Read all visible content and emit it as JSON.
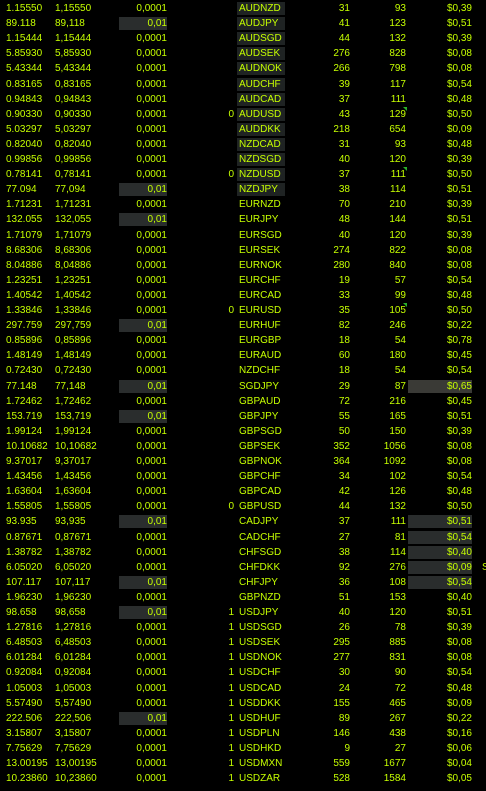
{
  "rows": [
    {
      "bid": "1.15550",
      "ask": "1,15550",
      "pip": "0,0001",
      "flag": "",
      "sym": "AUDNZD",
      "a": "31",
      "b": "93",
      "cost": "$0,39"
    },
    {
      "bid": "89.118",
      "ask": "89,118",
      "pip": "0,01",
      "flag": "",
      "sym": "AUDJPY",
      "a": "41",
      "b": "123",
      "cost": "$0,51"
    },
    {
      "bid": "1.15444",
      "ask": "1,15444",
      "pip": "0,0001",
      "flag": "",
      "sym": "AUDSGD",
      "a": "44",
      "b": "132",
      "cost": "$0,39"
    },
    {
      "bid": "5.85930",
      "ask": "5,85930",
      "pip": "0,0001",
      "flag": "",
      "sym": "AUDSEK",
      "a": "276",
      "b": "828",
      "cost": "$0,08"
    },
    {
      "bid": "5.43344",
      "ask": "5,43344",
      "pip": "0,0001",
      "flag": "",
      "sym": "AUDNOK",
      "a": "266",
      "b": "798",
      "cost": "$0,08"
    },
    {
      "bid": "0.83165",
      "ask": "0,83165",
      "pip": "0,0001",
      "flag": "",
      "sym": "AUDCHF",
      "a": "39",
      "b": "117",
      "cost": "$0,54"
    },
    {
      "bid": "0.94843",
      "ask": "0,94843",
      "pip": "0,0001",
      "flag": "",
      "sym": "AUDCAD",
      "a": "37",
      "b": "111",
      "cost": "$0,48"
    },
    {
      "bid": "0.90330",
      "ask": "0,90330",
      "pip": "0,0001",
      "flag": "0",
      "sym": "AUDUSD",
      "a": "43",
      "b": "129",
      "cost": "$0,50"
    },
    {
      "bid": "5.03297",
      "ask": "5,03297",
      "pip": "0,0001",
      "flag": "",
      "sym": "AUDDKK",
      "a": "218",
      "b": "654",
      "cost": "$0,09"
    },
    {
      "bid": "0.82040",
      "ask": "0,82040",
      "pip": "0,0001",
      "flag": "",
      "sym": "NZDCAD",
      "a": "31",
      "b": "93",
      "cost": "$0,48"
    },
    {
      "bid": "0.99856",
      "ask": "0,99856",
      "pip": "0,0001",
      "flag": "",
      "sym": "NZDSGD",
      "a": "40",
      "b": "120",
      "cost": "$0,39"
    },
    {
      "bid": "0.78141",
      "ask": "0,78141",
      "pip": "0,0001",
      "flag": "0",
      "sym": "NZDUSD",
      "a": "37",
      "b": "111",
      "cost": "$0,50"
    },
    {
      "bid": "77.094",
      "ask": "77,094",
      "pip": "0,01",
      "flag": "",
      "sym": "NZDJPY",
      "a": "38",
      "b": "114",
      "cost": "$0,51"
    },
    {
      "bid": "1.71231",
      "ask": "1,71231",
      "pip": "0,0001",
      "flag": "",
      "sym": "EURNZD",
      "a": "70",
      "b": "210",
      "cost": "$0,39"
    },
    {
      "bid": "132.055",
      "ask": "132,055",
      "pip": "0,01",
      "flag": "",
      "sym": "EURJPY",
      "a": "48",
      "b": "144",
      "cost": "$0,51"
    },
    {
      "bid": "1.71079",
      "ask": "1,71079",
      "pip": "0,0001",
      "flag": "",
      "sym": "EURSGD",
      "a": "40",
      "b": "120",
      "cost": "$0,39"
    },
    {
      "bid": "8.68306",
      "ask": "8,68306",
      "pip": "0,0001",
      "flag": "",
      "sym": "EURSEK",
      "a": "274",
      "b": "822",
      "cost": "$0,08"
    },
    {
      "bid": "8.04886",
      "ask": "8,04886",
      "pip": "0,0001",
      "flag": "",
      "sym": "EURNOK",
      "a": "280",
      "b": "840",
      "cost": "$0,08"
    },
    {
      "bid": "1.23251",
      "ask": "1,23251",
      "pip": "0,0001",
      "flag": "",
      "sym": "EURCHF",
      "a": "19",
      "b": "57",
      "cost": "$0,54"
    },
    {
      "bid": "1.40542",
      "ask": "1,40542",
      "pip": "0,0001",
      "flag": "",
      "sym": "EURCAD",
      "a": "33",
      "b": "99",
      "cost": "$0,48"
    },
    {
      "bid": "1.33846",
      "ask": "1,33846",
      "pip": "0,0001",
      "flag": "0",
      "sym": "EURUSD",
      "a": "35",
      "b": "105",
      "cost": "$0,50"
    },
    {
      "bid": "297.759",
      "ask": "297,759",
      "pip": "0,01",
      "flag": "",
      "sym": "EURHUF",
      "a": "82",
      "b": "246",
      "cost": "$0,22"
    },
    {
      "bid": "0.85896",
      "ask": "0,85896",
      "pip": "0,0001",
      "flag": "",
      "sym": "EURGBP",
      "a": "18",
      "b": "54",
      "cost": "$0,78"
    },
    {
      "bid": "1.48149",
      "ask": "1,48149",
      "pip": "0,0001",
      "flag": "",
      "sym": "EURAUD",
      "a": "60",
      "b": "180",
      "cost": "$0,45"
    },
    {
      "bid": "0.72430",
      "ask": "0,72430",
      "pip": "0,0001",
      "flag": "",
      "sym": "NZDCHF",
      "a": "18",
      "b": "54",
      "cost": "$0,54"
    },
    {
      "bid": "77.148",
      "ask": "77,148",
      "pip": "0,01",
      "flag": "",
      "sym": "SGDJPY",
      "a": "29",
      "b": "87",
      "cost": "$0,65"
    },
    {
      "bid": "1.72462",
      "ask": "1,72462",
      "pip": "0,0001",
      "flag": "",
      "sym": "GBPAUD",
      "a": "72",
      "b": "216",
      "cost": "$0,45"
    },
    {
      "bid": "153.719",
      "ask": "153,719",
      "pip": "0,01",
      "flag": "",
      "sym": "GBPJPY",
      "a": "55",
      "b": "165",
      "cost": "$0,51"
    },
    {
      "bid": "1.99124",
      "ask": "1,99124",
      "pip": "0,0001",
      "flag": "",
      "sym": "GBPSGD",
      "a": "50",
      "b": "150",
      "cost": "$0,39"
    },
    {
      "bid": "10.10682",
      "ask": "10,10682",
      "pip": "0,0001",
      "flag": "",
      "sym": "GBPSEK",
      "a": "352",
      "b": "1056",
      "cost": "$0,08"
    },
    {
      "bid": "9.37017",
      "ask": "9,37017",
      "pip": "0,0001",
      "flag": "",
      "sym": "GBPNOK",
      "a": "364",
      "b": "1092",
      "cost": "$0,08"
    },
    {
      "bid": "1.43456",
      "ask": "1,43456",
      "pip": "0,0001",
      "flag": "",
      "sym": "GBPCHF",
      "a": "34",
      "b": "102",
      "cost": "$0,54"
    },
    {
      "bid": "1.63604",
      "ask": "1,63604",
      "pip": "0,0001",
      "flag": "",
      "sym": "GBPCAD",
      "a": "42",
      "b": "126",
      "cost": "$0,48"
    },
    {
      "bid": "1.55805",
      "ask": "1,55805",
      "pip": "0,0001",
      "flag": "0",
      "sym": "GBPUSD",
      "a": "44",
      "b": "132",
      "cost": "$0,50"
    },
    {
      "bid": "93.935",
      "ask": "93,935",
      "pip": "0,01",
      "flag": "",
      "sym": "CADJPY",
      "a": "37",
      "b": "111",
      "cost": "$0,51"
    },
    {
      "bid": "0.87671",
      "ask": "0,87671",
      "pip": "0,0001",
      "flag": "",
      "sym": "CADCHF",
      "a": "27",
      "b": "81",
      "cost": "$0,54"
    },
    {
      "bid": "1.38782",
      "ask": "1,38782",
      "pip": "0,0001",
      "flag": "",
      "sym": "CHFSGD",
      "a": "38",
      "b": "114",
      "cost": "$0,40"
    },
    {
      "bid": "6.05020",
      "ask": "6,05020",
      "pip": "0,0001",
      "flag": "",
      "sym": "CHFDKK",
      "a": "92",
      "b": "276",
      "cost": "$0,09"
    },
    {
      "bid": "107.117",
      "ask": "107,117",
      "pip": "0,01",
      "flag": "",
      "sym": "CHFJPY",
      "a": "36",
      "b": "108",
      "cost": "$0,54"
    },
    {
      "bid": "1.96230",
      "ask": "1,96230",
      "pip": "0,0001",
      "flag": "",
      "sym": "GBPNZD",
      "a": "51",
      "b": "153",
      "cost": "$0,40"
    },
    {
      "bid": "98.658",
      "ask": "98,658",
      "pip": "0,01",
      "flag": "1",
      "sym": "USDJPY",
      "a": "40",
      "b": "120",
      "cost": "$0,51"
    },
    {
      "bid": "1.27816",
      "ask": "1,27816",
      "pip": "0,0001",
      "flag": "1",
      "sym": "USDSGD",
      "a": "26",
      "b": "78",
      "cost": "$0,39"
    },
    {
      "bid": "6.48503",
      "ask": "6,48503",
      "pip": "0,0001",
      "flag": "1",
      "sym": "USDSEK",
      "a": "295",
      "b": "885",
      "cost": "$0,08"
    },
    {
      "bid": "6.01284",
      "ask": "6,01284",
      "pip": "0,0001",
      "flag": "1",
      "sym": "USDNOK",
      "a": "277",
      "b": "831",
      "cost": "$0,08"
    },
    {
      "bid": "0.92084",
      "ask": "0,92084",
      "pip": "0,0001",
      "flag": "1",
      "sym": "USDCHF",
      "a": "30",
      "b": "90",
      "cost": "$0,54"
    },
    {
      "bid": "1.05003",
      "ask": "1,05003",
      "pip": "0,0001",
      "flag": "1",
      "sym": "USDCAD",
      "a": "24",
      "b": "72",
      "cost": "$0,48"
    },
    {
      "bid": "5.57490",
      "ask": "5,57490",
      "pip": "0,0001",
      "flag": "1",
      "sym": "USDDKK",
      "a": "155",
      "b": "465",
      "cost": "$0,09"
    },
    {
      "bid": "222.506",
      "ask": "222,506",
      "pip": "0,01",
      "flag": "1",
      "sym": "USDHUF",
      "a": "89",
      "b": "267",
      "cost": "$0,22"
    },
    {
      "bid": "3.15807",
      "ask": "3,15807",
      "pip": "0,0001",
      "flag": "1",
      "sym": "USDPLN",
      "a": "146",
      "b": "438",
      "cost": "$0,16"
    },
    {
      "bid": "7.75629",
      "ask": "7,75629",
      "pip": "0,0001",
      "flag": "1",
      "sym": "USDHKD",
      "a": "9",
      "b": "27",
      "cost": "$0,06"
    },
    {
      "bid": "13.00195",
      "ask": "13,00195",
      "pip": "0,0001",
      "flag": "1",
      "sym": "USDMXN",
      "a": "559",
      "b": "1677",
      "cost": "$0,04"
    },
    {
      "bid": "10.23860",
      "ask": "10,23860",
      "pip": "0,0001",
      "flag": "1",
      "sym": "USDZAR",
      "a": "528",
      "b": "1584",
      "cost": "$0,05"
    }
  ],
  "stray_char": "S",
  "colors": {
    "text": "#c6ff00",
    "marker": "#2ab02a",
    "cell_bg": "#2a2d2d",
    "sym_bg": "#1f2323"
  }
}
